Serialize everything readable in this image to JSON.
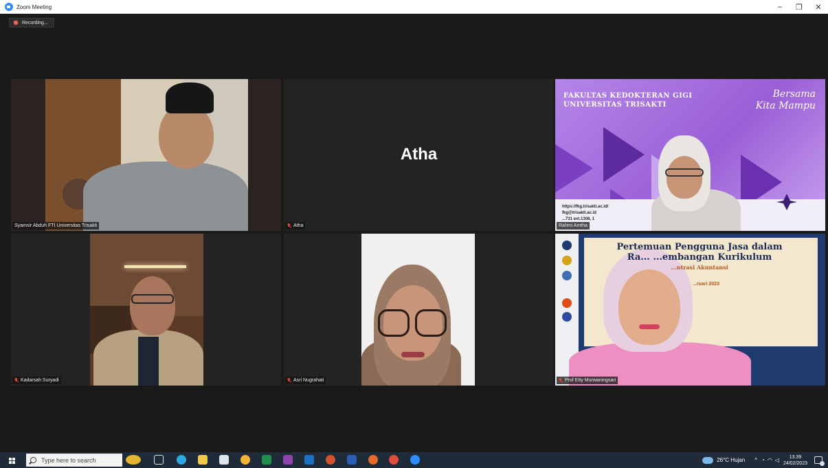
{
  "window": {
    "title": "Zoom Meeting",
    "minimize_glyph": "–",
    "maximize_glyph": "❐",
    "close_glyph": "✕"
  },
  "recording": {
    "label": "Recording..."
  },
  "participants": [
    {
      "name": "Syamsir Abduh FTI Universitas Trisakti",
      "active_speaker": true,
      "muted": false
    },
    {
      "name": "Atha",
      "display_name": "Atha",
      "video": false,
      "muted": true
    },
    {
      "name": "Rahmi Amtha",
      "muted": false
    },
    {
      "name": "Kadarsah Suryadi",
      "muted": true
    },
    {
      "name": "Asri Nugrahati",
      "muted": true
    },
    {
      "name": "Prof Etty Murwaningsari",
      "muted": true
    }
  ],
  "slide_fkg": {
    "title_line1": "FAKULTAS KEDOKTERAN GIGI",
    "title_line2": "UNIVERSITAS TRISAKTI",
    "motto_line1": "Bersama",
    "motto_line2": "Kita Mampu",
    "contact_web": "https://fkg.trisakti.ac.id/",
    "contact_email": "fkg@trisakti.ac.id",
    "contact_phone": "...731 ext.1308, 1"
  },
  "slide_meeting": {
    "title_line1": "Pertemuan Pengguna Jasa dalam",
    "title_line2": "Ra... ...embangan Kurikulum",
    "subtitle": "...ntrasi Akuntansi",
    "date": "...ruari 2023"
  },
  "taskbar": {
    "search_placeholder": "Type here to search",
    "weather": "26°C  Hujan",
    "time": "13.39",
    "date": "24/02/2023"
  },
  "colors": {
    "active_speaker_border": "#e1e66a",
    "muted_mic": "#e0443d",
    "zoom_blue": "#2d8cff",
    "taskbar_bg": "#1f2b38"
  }
}
